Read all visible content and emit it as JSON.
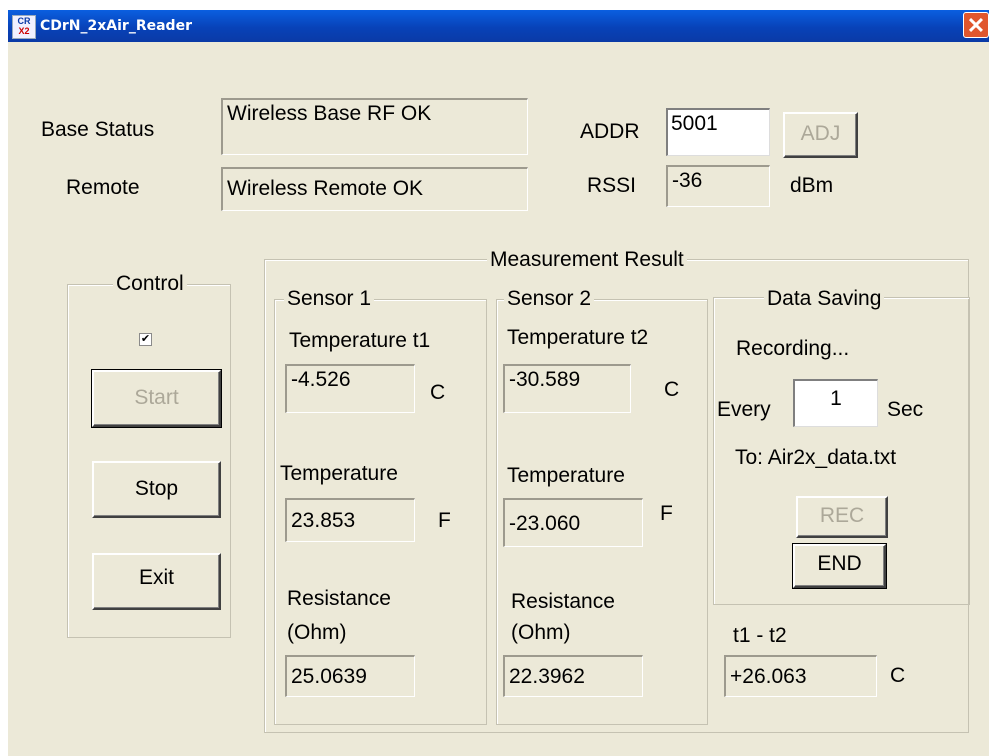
{
  "window": {
    "title": "CDrN_2xAir_Reader",
    "close_glyph": "✕",
    "app_icon": "cdrn-app-icon",
    "icon_text_top": "CR",
    "icon_text_bottom": "X2"
  },
  "status": {
    "base_label": "Base Status",
    "base_value": "Wireless Base RF OK",
    "remote_label": "Remote",
    "remote_value": "Wireless Remote OK",
    "addr_label": "ADDR",
    "addr_value": "5001",
    "adj_button": "ADJ",
    "rssi_label": "RSSI",
    "rssi_value": "-36",
    "rssi_unit": "dBm"
  },
  "control": {
    "title": "Control",
    "checkbox_checked": true,
    "check_glyph": "✔",
    "start_button": "Start",
    "stop_button": "Stop",
    "exit_button": "Exit"
  },
  "measurement": {
    "title": "Measurement Result",
    "sensor1": {
      "title": "Sensor 1",
      "temp_c_label": "Temperature t1",
      "temp_c_value": "-4.526",
      "temp_c_unit": "C",
      "temp_f_label": "Temperature",
      "temp_f_value": "23.853",
      "temp_f_unit": "F",
      "res_label_1": "Resistance",
      "res_label_2": "(Ohm)",
      "res_value": "25.0639"
    },
    "sensor2": {
      "title": "Sensor 2",
      "temp_c_label": "Temperature t2",
      "temp_c_value": "-30.589",
      "temp_c_unit": "C",
      "temp_f_label": "Temperature",
      "temp_f_value": "-23.060",
      "temp_f_unit": "F",
      "res_label_1": "Resistance",
      "res_label_2": "(Ohm)",
      "res_value": "22.3962"
    },
    "data_saving": {
      "title": "Data Saving",
      "status": "Recording...",
      "every_label": "Every",
      "interval_value": "1",
      "sec_label": "Sec",
      "file_label": "To: Air2x_data.txt",
      "rec_button": "REC",
      "end_button": "END"
    },
    "diff": {
      "label": "t1 - t2",
      "value": "+26.063",
      "unit": "C"
    }
  }
}
